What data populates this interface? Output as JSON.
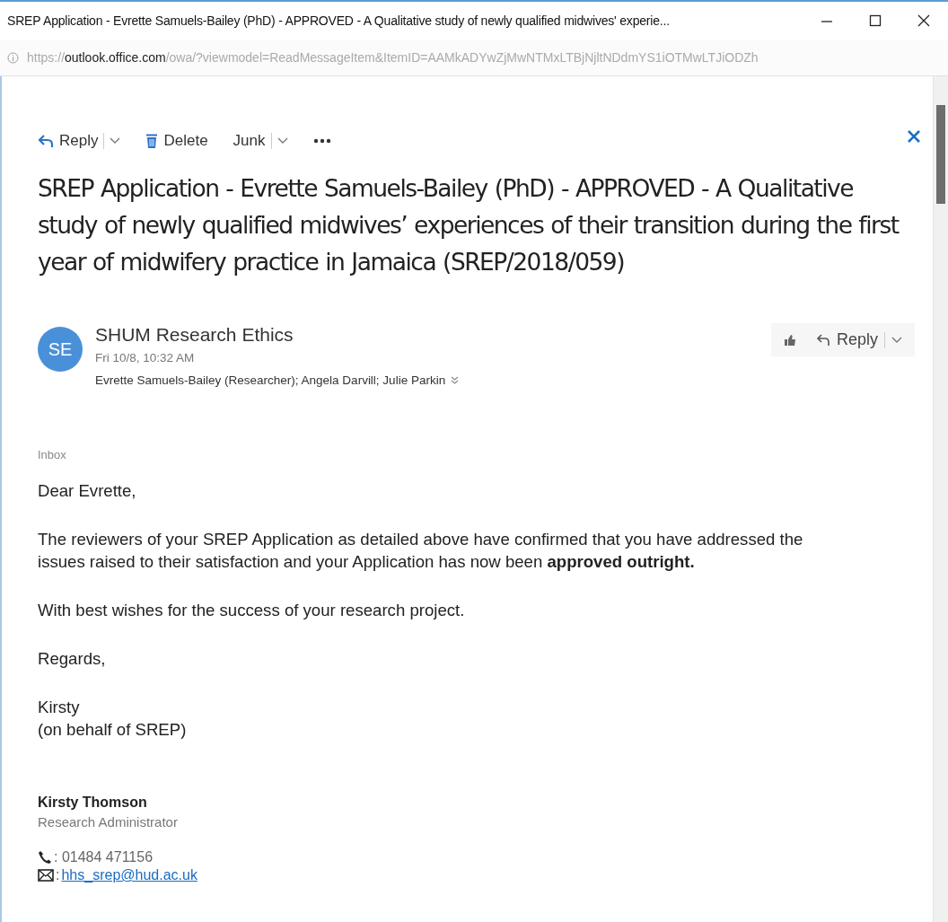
{
  "window": {
    "title": "SREP Application - Evrette Samuels-Bailey (PhD) - APPROVED - A Qualitative study of newly qualified midwives' experie..."
  },
  "address_bar": {
    "scheme": "https://",
    "host": "outlook.office.com",
    "path": "/owa/?viewmodel=ReadMessageItem&ItemID=AAMkADYwZjMwNTMxLTBjNjltNDdmYS1iOTMwLTJiODZh"
  },
  "toolbar": [
    {
      "kind": "reply",
      "label": "Reply"
    },
    {
      "kind": "delete",
      "label": "Delete"
    },
    {
      "kind": "junk",
      "label": "Junk"
    },
    {
      "kind": "more"
    }
  ],
  "subject": "SREP Application - Evrette Samuels-Bailey (PhD) - APPROVED - A Qualitative study of newly qualified midwives’ experiences of their transition during the first year of midwifery practice in Jamaica (SREP/2018/059)",
  "message": {
    "avatar": "SE",
    "sender": "SHUM Research Ethics",
    "date": "Fri 10/8, 10:32 AM",
    "recipients": "Evrette Samuels-Bailey (Researcher); Angela Darvill; Julie Parkin",
    "reply_label": "Reply",
    "folder": "Inbox"
  },
  "body": [
    {
      "lines": [
        "Dear Evrette,"
      ]
    },
    {
      "lines": [
        "The reviewers of your SREP Application as detailed above have confirmed that you have addressed the issues raised to their satisfaction and your Application has now been **approved outright.**"
      ]
    },
    {
      "lines": [
        "With best wishes for the success of your research project."
      ]
    },
    {
      "lines": [
        "Regards,"
      ]
    },
    {
      "lines": [
        "Kirsty",
        "(on behalf of SREP)"
      ]
    }
  ],
  "signature": {
    "name": "Kirsty Thomson",
    "role": "Research Administrator",
    "phone": ": 01484 471156",
    "email_label": ":",
    "email": "hhs_srep@hud.ac.uk"
  }
}
